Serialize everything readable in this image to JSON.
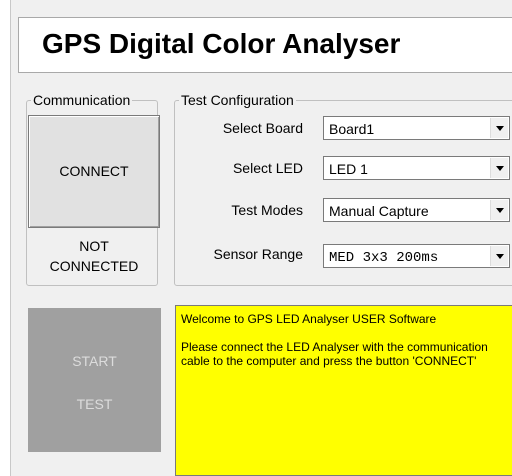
{
  "header": {
    "title": "GPS Digital Color Analyser"
  },
  "communication": {
    "group_label": "Communication",
    "connect_label": "CONNECT",
    "status_line1": "NOT",
    "status_line2": "CONNECTED"
  },
  "test_config": {
    "group_label": "Test Configuration",
    "board": {
      "label": "Select Board",
      "value": "Board1"
    },
    "led": {
      "label": "Select LED",
      "value": "LED 1"
    },
    "mode": {
      "label": "Test Modes",
      "value": "Manual Capture"
    },
    "range": {
      "label": "Sensor Range",
      "value": "MED 3x3 200ms"
    }
  },
  "start_button": {
    "line1": "START",
    "line2": "TEST"
  },
  "log": {
    "line1": "Welcome to GPS LED Analyser USER Software",
    "line2": "Please connect the LED Analyser with the communication cable to the computer and press the button 'CONNECT'"
  },
  "colors": {
    "log_background": "#ffff00",
    "start_disabled": "#a0a0a0"
  }
}
